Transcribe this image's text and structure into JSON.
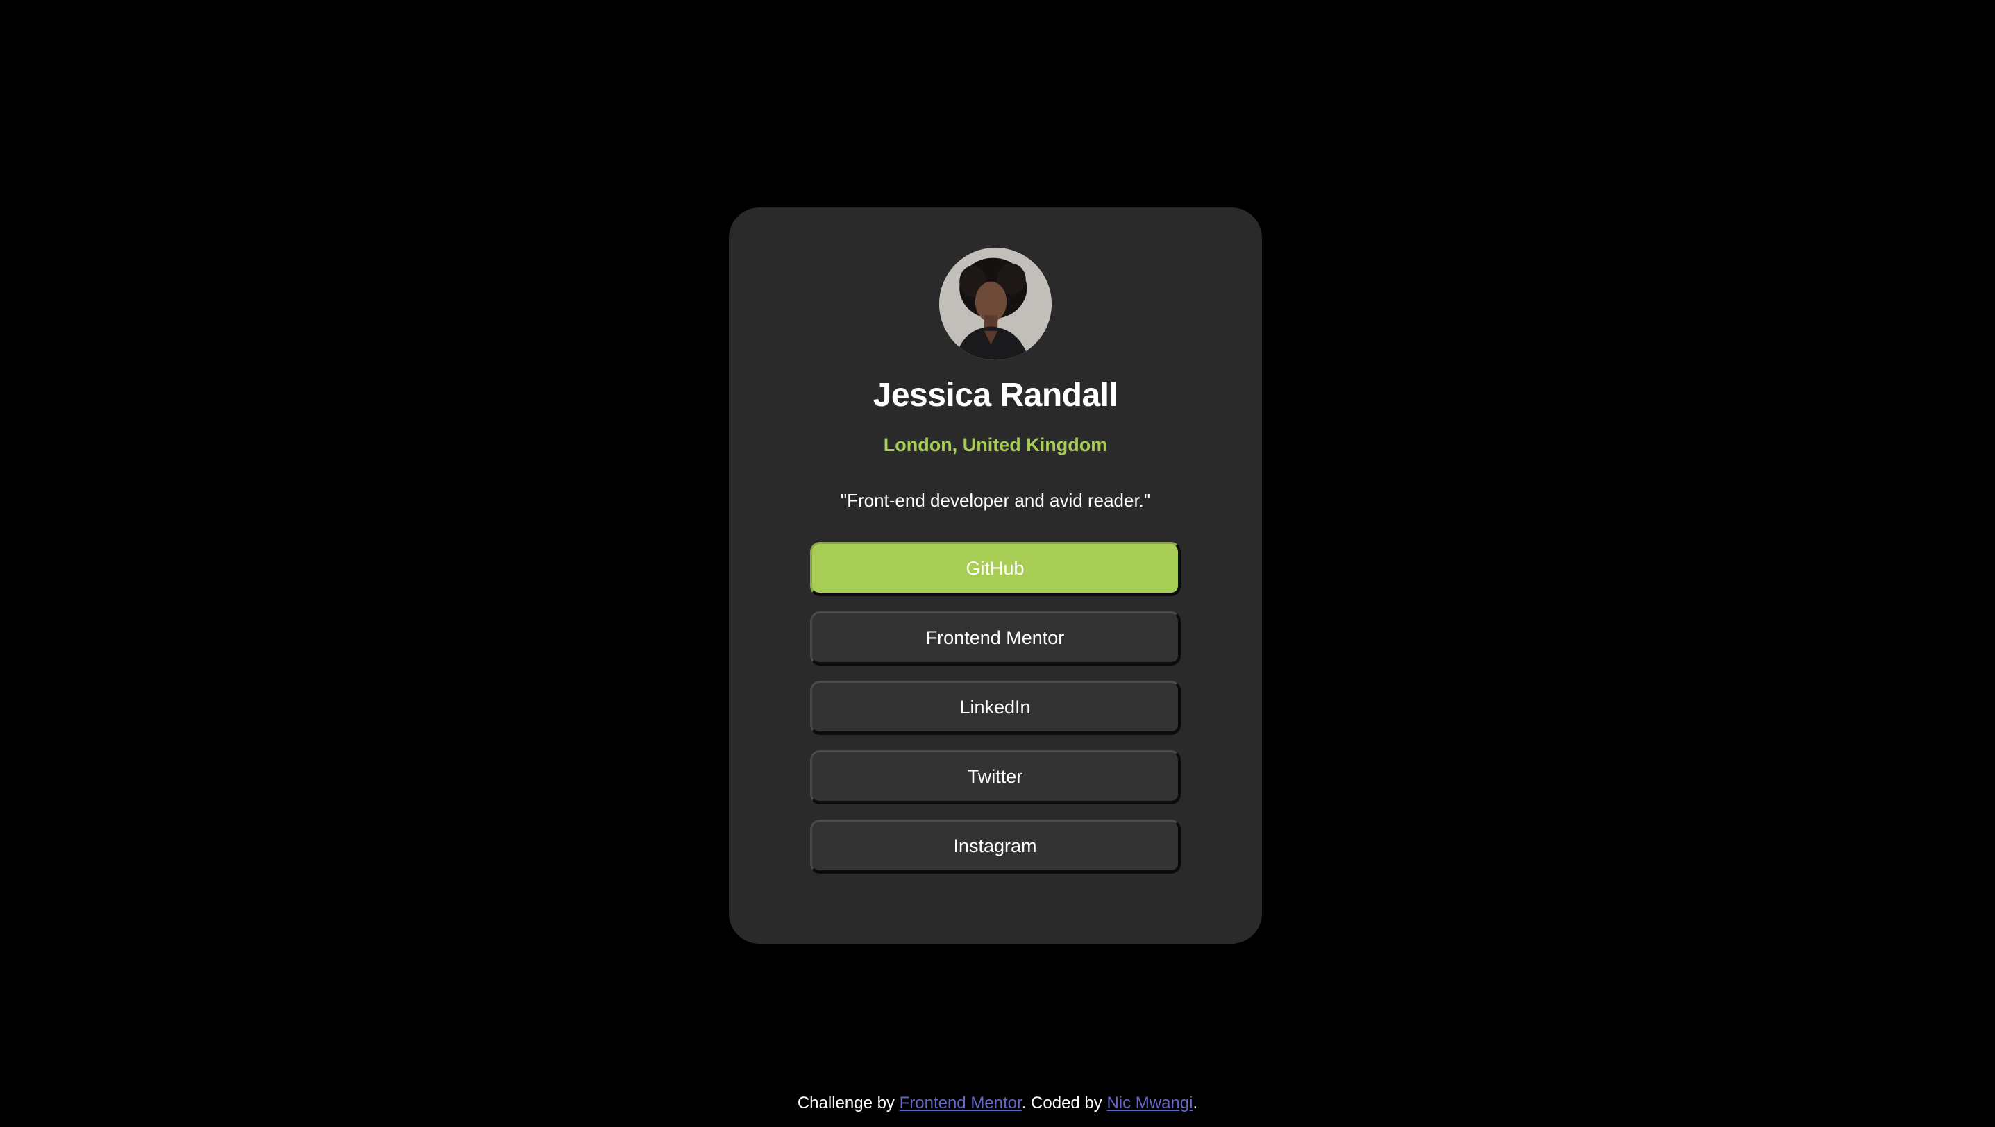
{
  "profile": {
    "name": "Jessica Randall",
    "location": "London, United Kingdom",
    "bio": "\"Front-end developer and avid reader.\"",
    "avatar_icon": "profile-photo"
  },
  "links": [
    {
      "label": "GitHub",
      "active": true
    },
    {
      "label": "Frontend Mentor",
      "active": false
    },
    {
      "label": "LinkedIn",
      "active": false
    },
    {
      "label": "Twitter",
      "active": false
    },
    {
      "label": "Instagram",
      "active": false
    }
  ],
  "footer": {
    "challenge_prefix": "Challenge by ",
    "challenge_link": "Frontend Mentor",
    "coded_prefix": ". Coded by ",
    "coded_link": "Nic Mwangi",
    "suffix": "."
  },
  "colors": {
    "background": "#000000",
    "card": "#2a2a2b",
    "accent": "#a7cd54",
    "button": "#333334",
    "footer_link": "#6567c9"
  }
}
